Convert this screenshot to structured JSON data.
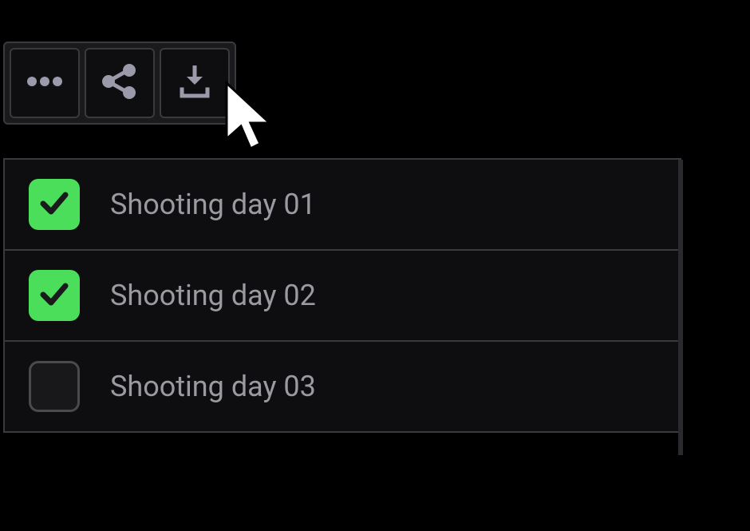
{
  "toolbar": {
    "buttons": [
      {
        "name": "more-options",
        "icon": "more-horizontal"
      },
      {
        "name": "share",
        "icon": "share"
      },
      {
        "name": "download",
        "icon": "download"
      }
    ]
  },
  "list": {
    "items": [
      {
        "label": "Shooting day 01",
        "checked": true
      },
      {
        "label": "Shooting day 02",
        "checked": true
      },
      {
        "label": "Shooting day 03",
        "checked": false
      }
    ]
  },
  "colors": {
    "background": "#000000",
    "panel": "#0e0e10",
    "border": "#3a3a3e",
    "text": "#9a9aa0",
    "checkbox_checked": "#4ade5a",
    "checkbox_check_stroke": "#1a1a1c"
  }
}
